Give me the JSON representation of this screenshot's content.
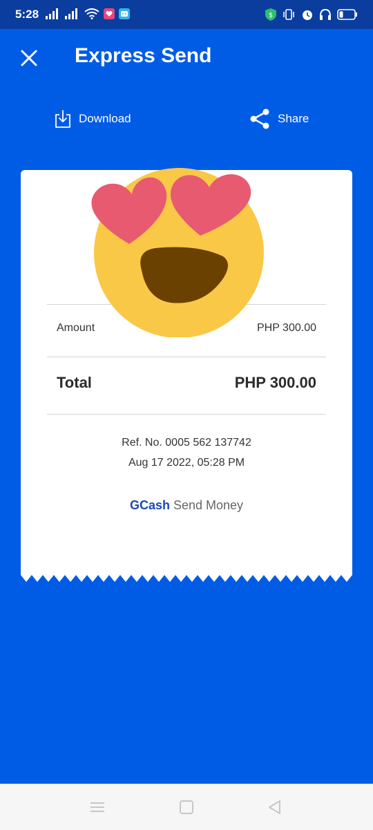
{
  "status_bar": {
    "time": "5:28",
    "icons": [
      "signal-bars-icon",
      "signal-bars-icon",
      "wifi-icon",
      "app-notification-icon",
      "app-notification-icon",
      "vpn-shield-icon",
      "vibrate-icon",
      "alarm-icon",
      "headset-icon",
      "battery-icon"
    ]
  },
  "header": {
    "title": "Express Send",
    "close_icon": "close-icon"
  },
  "actions": {
    "download_label": "Download",
    "share_label": "Share",
    "download_icon": "download-icon",
    "share_icon": "share-icon"
  },
  "receipt": {
    "amount_label": "Amount",
    "amount_value": "PHP 300.00",
    "total_label": "Total",
    "total_value": "PHP 300.00",
    "ref_line": "Ref. No. 0005 562 137742",
    "date_line": "Aug 17 2022, 05:28 PM",
    "brand_name": "GCash",
    "brand_suffix": "Send Money",
    "overlay": "heart-eyes-emoji"
  },
  "colors": {
    "background": "#005CE5",
    "status_bar": "#0A3D9E",
    "brand_text": "#1A47B8",
    "emoji_face": "#F9C846",
    "emoji_hearts": "#E75A70"
  },
  "nav_bar": {
    "icons": [
      "menu-icon",
      "home-icon",
      "back-icon"
    ]
  }
}
